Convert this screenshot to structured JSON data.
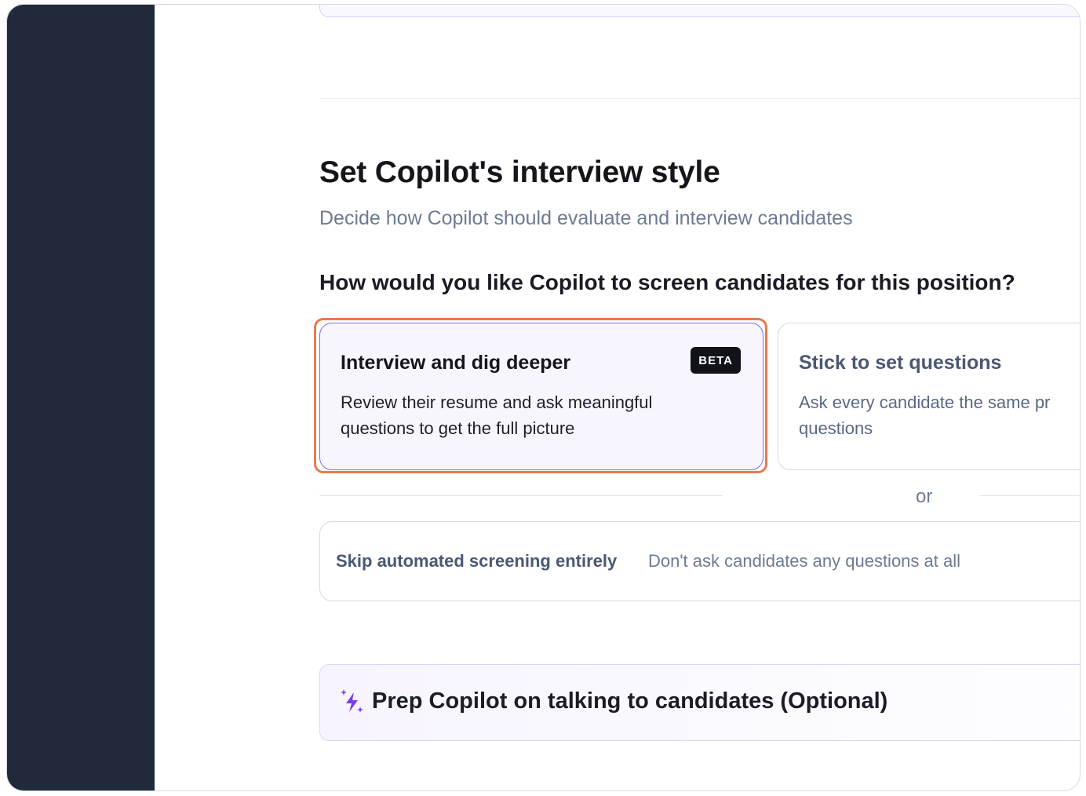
{
  "section": {
    "title": "Set Copilot's interview style",
    "subtitle": "Decide how Copilot should evaluate and interview candidates",
    "question": "How would you like Copilot to screen candidates for this position?"
  },
  "options": [
    {
      "title": "Interview and dig deeper",
      "badge": "BETA",
      "description_lines": [
        "Review their resume and ask meaningful",
        "questions to get the full picture"
      ],
      "selected": true
    },
    {
      "title": "Stick to set questions",
      "description_lines": [
        "Ask every candidate the same pr",
        "questions"
      ],
      "selected": false
    }
  ],
  "separator": {
    "label": "or"
  },
  "skip": {
    "title": "Skip automated screening entirely",
    "description": "Don't ask candidates any questions at all"
  },
  "prep": {
    "title": "Prep Copilot on talking to candidates (Optional)",
    "icon": "sparkle-icon"
  },
  "colors": {
    "sidebar": "#212a3b",
    "accent": "#7c6bf0",
    "highlight": "#e97a4d",
    "sparkle": "#7a3cf0"
  }
}
